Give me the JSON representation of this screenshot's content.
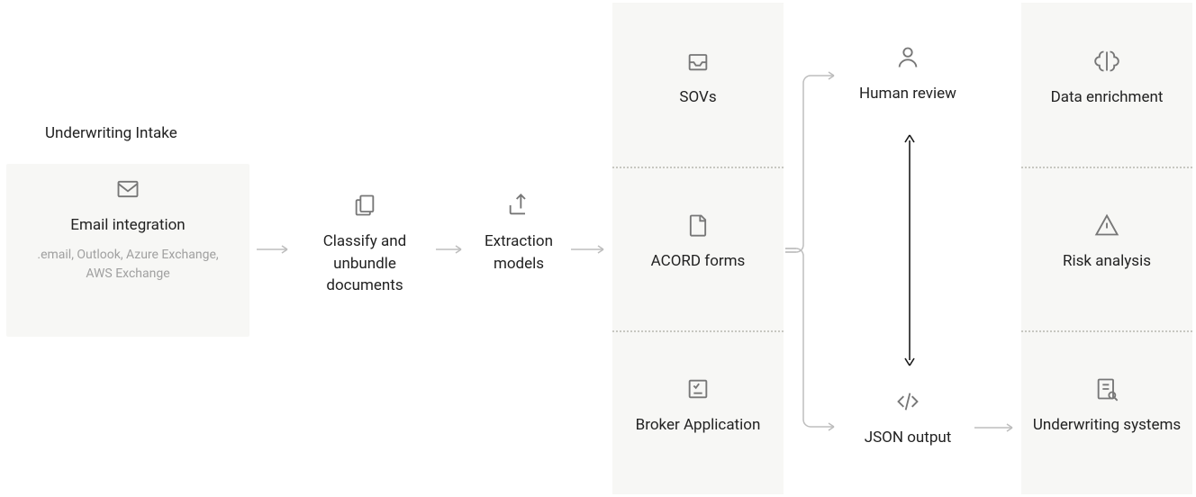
{
  "section_title": "Underwriting Intake",
  "email_card": {
    "label": "Email integration",
    "sublabel": ".email, Outlook, Azure Exchange, AWS Exchange"
  },
  "classify": {
    "label": "Classify and unbundle documents"
  },
  "extraction": {
    "label": "Extraction models"
  },
  "col_docs": {
    "items": [
      "SOVs",
      "ACORD forms",
      "Broker Application"
    ]
  },
  "human_review": {
    "label": "Human review"
  },
  "json_output": {
    "label": "JSON output"
  },
  "col_out": {
    "items": [
      "Data enrichment",
      "Risk analysis",
      "Underwriting systems"
    ]
  }
}
